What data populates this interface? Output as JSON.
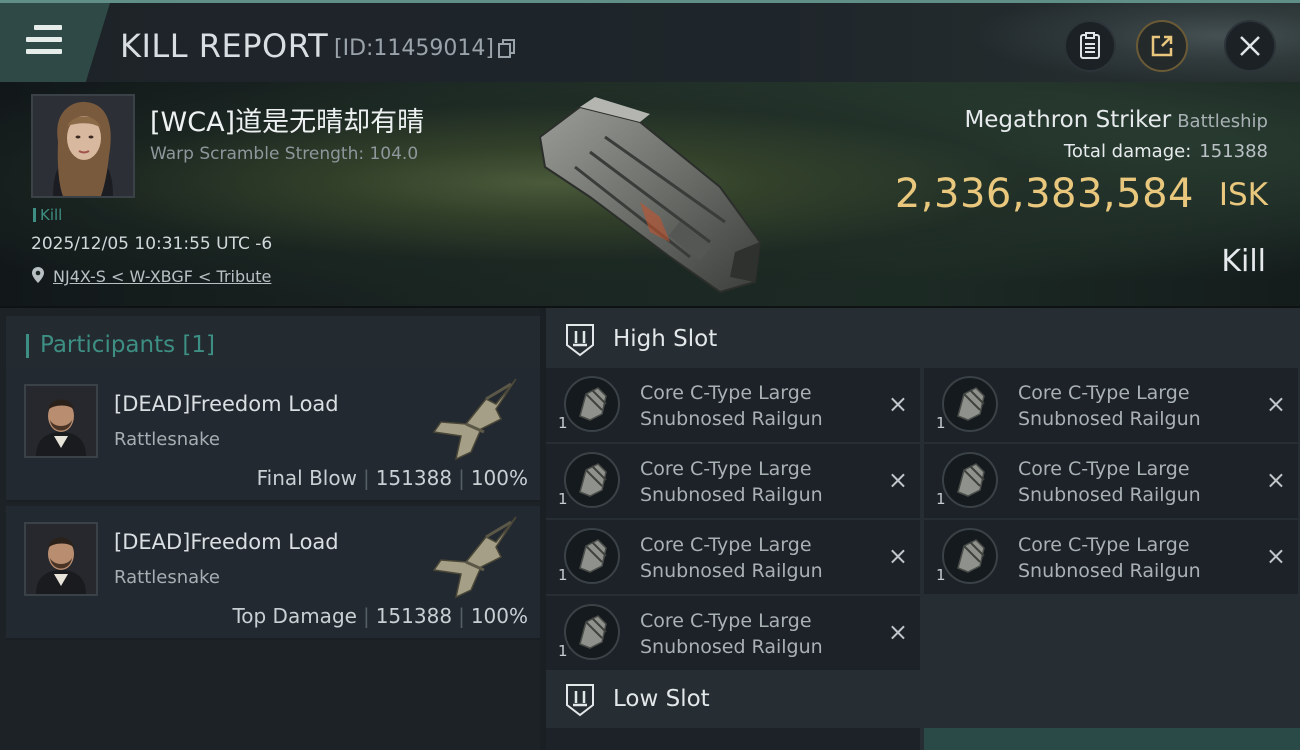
{
  "header": {
    "title": "KILL REPORT",
    "report_id": "[ID:11459014]"
  },
  "victim": {
    "name": "[WCA]道是无晴却有晴",
    "warp_scramble": "Warp Scramble Strength: 104.0",
    "kill_tag": "Kill",
    "timestamp": "2025/12/05 10:31:55 UTC -6",
    "location": "NJ4X-S < W-XBGF < Tribute",
    "ship_name": "Megathron Striker",
    "ship_class": "Battleship",
    "total_damage_label": "Total damage:",
    "total_damage_value": "151388",
    "isk_value": "2,336,383,584",
    "isk_unit": "ISK",
    "result": "Kill"
  },
  "participants": {
    "label": "Participants",
    "count": "[1]",
    "items": [
      {
        "name": "[DEAD]Freedom Load",
        "ship": "Rattlesnake",
        "role": "Final Blow",
        "damage": "151388",
        "percent": "100%"
      },
      {
        "name": "[DEAD]Freedom Load",
        "ship": "Rattlesnake",
        "role": "Top Damage",
        "damage": "151388",
        "percent": "100%"
      }
    ]
  },
  "high_slot": {
    "title": "High Slot",
    "modules": [
      {
        "line1": "Core C-Type Large",
        "line2": "Snubnosed Railgun",
        "qty": "1"
      },
      {
        "line1": "Core C-Type Large",
        "line2": "Snubnosed Railgun",
        "qty": "1"
      },
      {
        "line1": "Core C-Type Large",
        "line2": "Snubnosed Railgun",
        "qty": "1"
      },
      {
        "line1": "Core C-Type Large",
        "line2": "Snubnosed Railgun",
        "qty": "1"
      },
      {
        "line1": "Core C-Type Large",
        "line2": "Snubnosed Railgun",
        "qty": "1"
      },
      {
        "line1": "Core C-Type Large",
        "line2": "Snubnosed Railgun",
        "qty": "1"
      },
      {
        "line1": "Core C-Type Large",
        "line2": "Snubnosed Railgun",
        "qty": "1"
      }
    ]
  },
  "low_slot": {
    "title": "Low Slot"
  },
  "icons": {
    "close": "×",
    "destroyed": "×"
  },
  "colors": {
    "accent": "#3e8f83",
    "isk_gold": "#e9c87e"
  }
}
